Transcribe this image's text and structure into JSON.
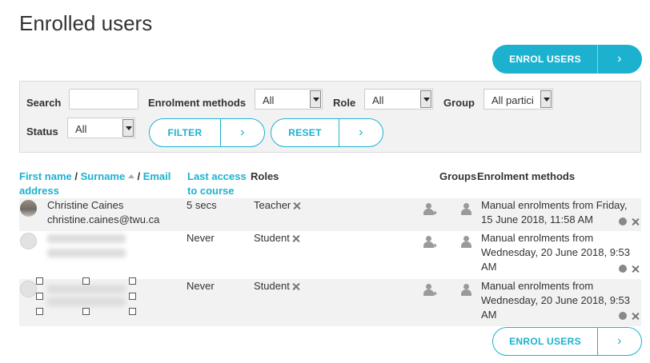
{
  "page": {
    "title": "Enrolled users"
  },
  "actions": {
    "enrol_label": "ENROL USERS",
    "arrow": "›"
  },
  "filters": {
    "search_label": "Search",
    "search_value": "",
    "enrol_methods_label": "Enrolment methods",
    "enrol_methods_value": "All",
    "role_label": "Role",
    "role_value": "All",
    "group_label": "Group",
    "group_value": "All partici",
    "status_label": "Status",
    "status_value": "All",
    "filter_label": "FILTER",
    "reset_label": "RESET"
  },
  "table": {
    "headers": {
      "first_name": "First name",
      "slash1": " / ",
      "surname": "Surname",
      "slash2": " / ",
      "email": "Email",
      "address": "address",
      "last_access_1": "Last access",
      "last_access_2": "to course",
      "roles": "Roles",
      "groups": "Groups",
      "enrol_methods": "Enrolment methods"
    },
    "rows": [
      {
        "name": "Christine Caines",
        "email": "christine.caines@twu.ca",
        "last_access": "5 secs",
        "role": "Teacher",
        "enrol_1": "Manual enrolments from Friday,",
        "enrol_2": "15 June 2018, 11:58 AM",
        "enrol_3": ""
      },
      {
        "name": "",
        "email": "",
        "last_access": "Never",
        "role": "Student",
        "enrol_1": "Manual enrolments from",
        "enrol_2": "Wednesday, 20 June 2018, 9:53",
        "enrol_3": "AM"
      },
      {
        "name": "",
        "email": "",
        "last_access": "Never",
        "role": "Student",
        "enrol_1": "Manual enrolments from",
        "enrol_2": "Wednesday, 20 June 2018, 9:53",
        "enrol_3": "AM"
      }
    ]
  },
  "colors": {
    "accent": "#1cb2cf",
    "row_shade": "#f2f2f2"
  },
  "icons": [
    "sort-asc-icon",
    "remove-role-icon",
    "add-role-icon",
    "group-icon",
    "gear-icon",
    "close-icon",
    "user-avatar-icon"
  ]
}
